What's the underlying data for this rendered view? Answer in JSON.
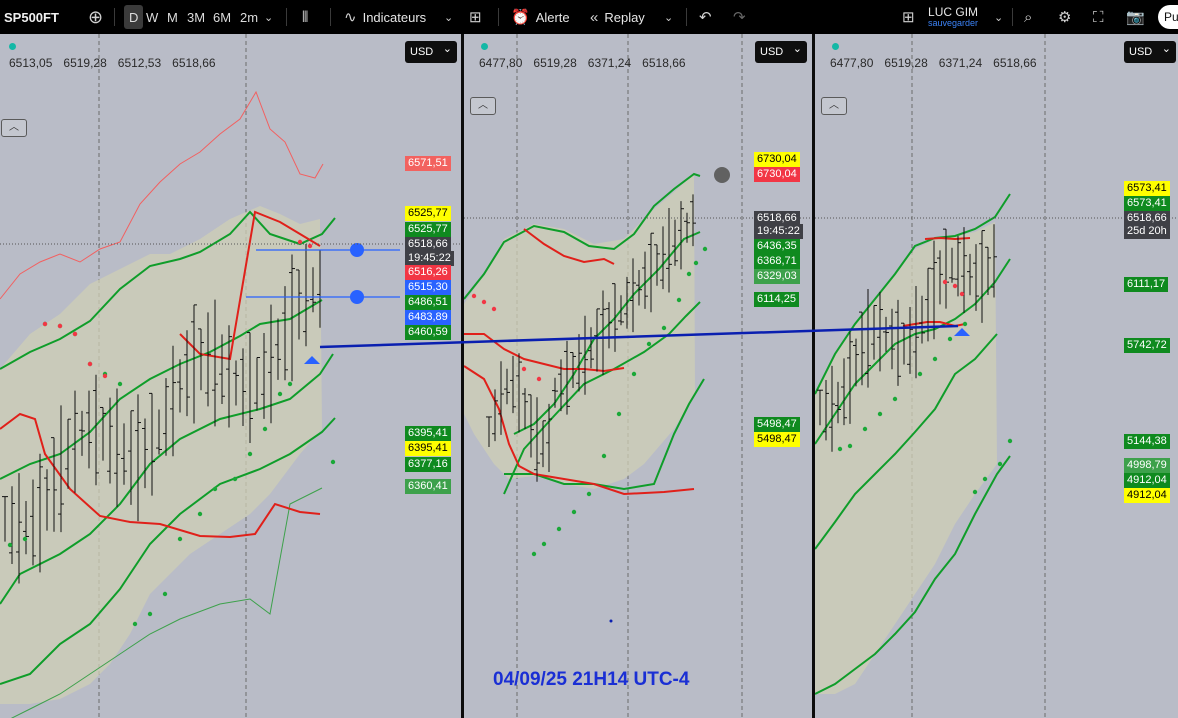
{
  "toolbar": {
    "symbol": "SP500FT",
    "timeframes": [
      "D",
      "W",
      "M",
      "3M",
      "6M",
      "2m"
    ],
    "active_timeframe": "D",
    "indicators_label": "Indicateurs",
    "alert_label": "Alerte",
    "replay_label": "Replay",
    "user_name": "LUC GIM",
    "user_status": "sauvegarder",
    "publish_label": "Pu"
  },
  "panes": [
    {
      "ohlc": [
        "6513,05",
        "6519,28",
        "6512,53",
        "6518,66"
      ],
      "currency": "USD",
      "price_labels": [
        {
          "text": "6571,51",
          "style": "lred"
        },
        {
          "text": "6525,77",
          "style": "yellow"
        },
        {
          "text": "6525,77",
          "style": "green"
        },
        {
          "text": "6518,66",
          "style": "dark"
        },
        {
          "text": "19:45:22",
          "style": "dark"
        },
        {
          "text": "6516,26",
          "style": "red"
        },
        {
          "text": "6515,30",
          "style": "blue"
        },
        {
          "text": "6486,51",
          "style": "green"
        },
        {
          "text": "6483,89",
          "style": "blue"
        },
        {
          "text": "6460,59",
          "style": "green"
        },
        {
          "text": "6395,41",
          "style": "green"
        },
        {
          "text": "6395,41",
          "style": "yellow"
        },
        {
          "text": "6377,16",
          "style": "green"
        },
        {
          "text": "6360,41",
          "style": "lgreen"
        }
      ]
    },
    {
      "ohlc": [
        "6477,80",
        "6519,28",
        "6371,24",
        "6518,66"
      ],
      "currency": "USD",
      "price_labels": [
        {
          "text": "6730,04",
          "style": "yellow"
        },
        {
          "text": "6730,04",
          "style": "red"
        },
        {
          "text": "6518,66",
          "style": "dark"
        },
        {
          "text": "19:45:22",
          "style": "dark"
        },
        {
          "text": "6436,35",
          "style": "green"
        },
        {
          "text": "6368,71",
          "style": "green"
        },
        {
          "text": "6329,03",
          "style": "lgreen"
        },
        {
          "text": "6114,25",
          "style": "green"
        },
        {
          "text": "5498,47",
          "style": "green"
        },
        {
          "text": "5498,47",
          "style": "yellow"
        }
      ]
    },
    {
      "ohlc": [
        "6477,80",
        "6519,28",
        "6371,24",
        "6518,66"
      ],
      "currency": "USD",
      "price_labels": [
        {
          "text": "6573,41",
          "style": "yellow"
        },
        {
          "text": "6573,41",
          "style": "green"
        },
        {
          "text": "6518,66",
          "style": "dark"
        },
        {
          "text": "25d 20h",
          "style": "dark"
        },
        {
          "text": "6111,17",
          "style": "green"
        },
        {
          "text": "5742,72",
          "style": "green"
        },
        {
          "text": "5144,38",
          "style": "green"
        },
        {
          "text": "4998,79",
          "style": "lgreen"
        },
        {
          "text": "4912,04",
          "style": "green"
        },
        {
          "text": "4912,04",
          "style": "yellow"
        }
      ]
    }
  ],
  "annotation": "04/09/25 21H14 UTC-4",
  "colors": {
    "background": "#b9bcc7",
    "band_fill": "#cfcfb6",
    "upper_band": "#0f9d2a",
    "median": "#e0201a",
    "dots_bull": "#1aa838",
    "dots_bear": "#f23645",
    "trendline": "#0a1fb0",
    "hline": "#2962ff"
  }
}
